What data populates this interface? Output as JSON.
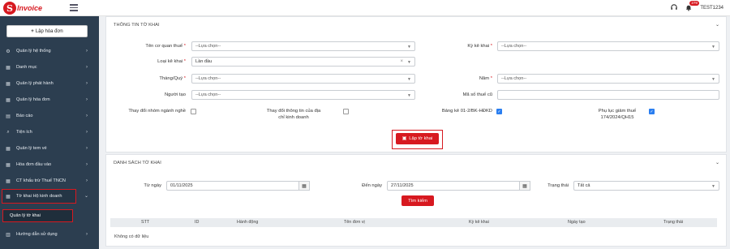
{
  "topbar": {
    "logo_letter": "S",
    "logo_text": "Invoice",
    "notification_count": "279",
    "username": "TEST1234"
  },
  "sidebar": {
    "create_label": "Lập hóa đơn",
    "items": [
      {
        "label": "Quản lý hệ thống",
        "icon": "gear-icon"
      },
      {
        "label": "Danh mục",
        "icon": "grid-icon"
      },
      {
        "label": "Quản lý phát hành",
        "icon": "grid-icon"
      },
      {
        "label": "Quản lý hóa đơn",
        "icon": "grid-icon"
      },
      {
        "label": "Báo cáo",
        "icon": "report-icon"
      },
      {
        "label": "Tiện ích",
        "icon": "search-icon"
      },
      {
        "label": "Quản lý tem vé",
        "icon": "grid-icon"
      },
      {
        "label": "Hóa đơn đầu vào",
        "icon": "grid-icon"
      },
      {
        "label": "CT khấu trừ Thuế TNCN",
        "icon": "grid-icon"
      },
      {
        "label": "Tờ khai Hộ kinh doanh",
        "icon": "grid-icon"
      },
      {
        "label": "Hướng dẫn sử dụng",
        "icon": "book-icon"
      }
    ],
    "sub_item": "Quản lý tờ khai"
  },
  "info": {
    "title": "THÔNG TIN TỜ KHAI",
    "tax_office_label": "Tên cơ quan thuế",
    "tax_office_value": "--Lựa chọn--",
    "period_label": "Kỳ kê khai",
    "period_value": "--Lựa chọn--",
    "declaration_type_label": "Loại kê khai",
    "declaration_type_value": "Lần đầu",
    "month_label": "Tháng/Quý",
    "month_value": "--Lựa chọn--",
    "year_label": "Năm",
    "year_value": "--Lựa chọn--",
    "creator_label": "Người tạo",
    "creator_value": "--Lựa chọn--",
    "old_tax_code_label": "Mã số thuế cũ",
    "old_tax_code_value": "",
    "change_group_label": "Thay đổi nhóm ngành nghề",
    "change_info_label_1": "Thay đổi thông tin của địa",
    "change_info_label_2": "chỉ kinh doanh",
    "bk_label": "Bảng kê 01-2/BK-HĐKD",
    "appendix_label_1": "Phụ lục giảm thuế",
    "appendix_label_2": "174/2024/QH15",
    "create_button": "Lập tờ khai"
  },
  "list": {
    "title": "DANH SÁCH TỜ KHAI",
    "from_label": "Từ ngày",
    "from_value": "01/11/2025",
    "to_label": "Đến ngày",
    "to_value": "27/11/2025",
    "status_label": "Trạng thái",
    "status_value": "Tất cả",
    "search_button": "Tìm kiếm",
    "columns": [
      "STT",
      "ID",
      "Hành động",
      "Tên đơn vị",
      "Kỳ kê khai",
      "Ngày tạo",
      "Trạng thái"
    ],
    "empty_text": "Không có dữ liệu"
  }
}
